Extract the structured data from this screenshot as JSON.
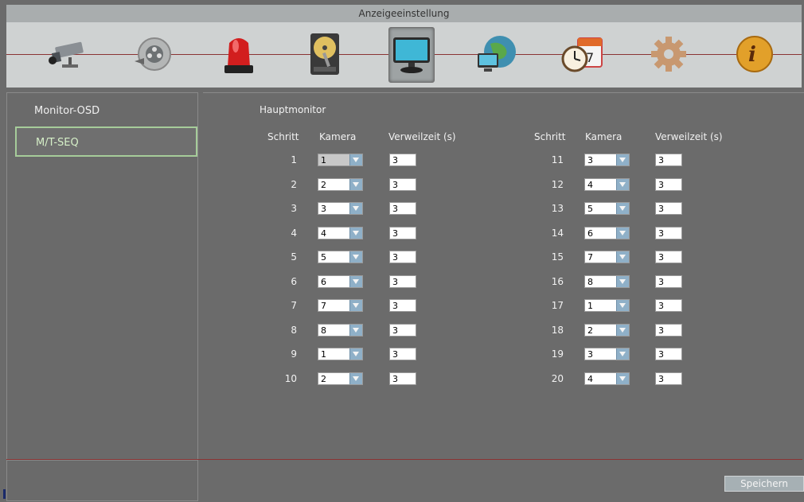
{
  "window": {
    "title": "Anzeigeeinstellung"
  },
  "toolbar": {
    "icons": [
      "camera-icon",
      "playback-reel-icon",
      "alarm-siren-icon",
      "hard-disk-icon",
      "monitor-icon",
      "network-globe-icon",
      "schedule-clock-icon",
      "settings-gear-icon",
      "info-icon"
    ],
    "active_index": 4
  },
  "menu": {
    "items": [
      {
        "label": "Monitor-OSD"
      },
      {
        "label": "M/T-SEQ"
      }
    ],
    "selected": 1
  },
  "main": {
    "section_title": "Hauptmonitor",
    "columns": {
      "step": "Schritt",
      "camera": "Kamera",
      "dwell": "Verweilzeit  (s)"
    },
    "left_rows": [
      {
        "step": "1",
        "camera": "1",
        "dwell": "3"
      },
      {
        "step": "2",
        "camera": "2",
        "dwell": "3"
      },
      {
        "step": "3",
        "camera": "3",
        "dwell": "3"
      },
      {
        "step": "4",
        "camera": "4",
        "dwell": "3"
      },
      {
        "step": "5",
        "camera": "5",
        "dwell": "3"
      },
      {
        "step": "6",
        "camera": "6",
        "dwell": "3"
      },
      {
        "step": "7",
        "camera": "7",
        "dwell": "3"
      },
      {
        "step": "8",
        "camera": "8",
        "dwell": "3"
      },
      {
        "step": "9",
        "camera": "1",
        "dwell": "3"
      },
      {
        "step": "10",
        "camera": "2",
        "dwell": "3"
      }
    ],
    "right_rows": [
      {
        "step": "11",
        "camera": "3",
        "dwell": "3"
      },
      {
        "step": "12",
        "camera": "4",
        "dwell": "3"
      },
      {
        "step": "13",
        "camera": "5",
        "dwell": "3"
      },
      {
        "step": "14",
        "camera": "6",
        "dwell": "3"
      },
      {
        "step": "15",
        "camera": "7",
        "dwell": "3"
      },
      {
        "step": "16",
        "camera": "8",
        "dwell": "3"
      },
      {
        "step": "17",
        "camera": "1",
        "dwell": "3"
      },
      {
        "step": "18",
        "camera": "2",
        "dwell": "3"
      },
      {
        "step": "19",
        "camera": "3",
        "dwell": "3"
      },
      {
        "step": "20",
        "camera": "4",
        "dwell": "3"
      }
    ],
    "focused_camera_step": "1"
  },
  "buttons": {
    "save": "Speichern"
  }
}
